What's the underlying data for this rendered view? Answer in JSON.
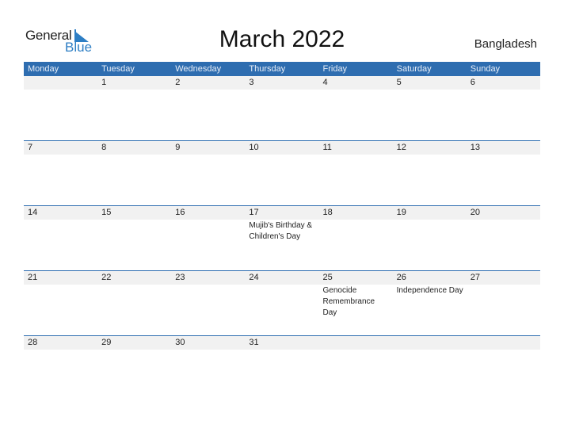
{
  "logo": {
    "general": "General",
    "blue": "Blue"
  },
  "title": "March 2022",
  "country": "Bangladesh",
  "weekdays": [
    "Monday",
    "Tuesday",
    "Wednesday",
    "Thursday",
    "Friday",
    "Saturday",
    "Sunday"
  ],
  "weeks": [
    {
      "days": [
        "",
        "1",
        "2",
        "3",
        "4",
        "5",
        "6"
      ],
      "events": [
        "",
        "",
        "",
        "",
        "",
        "",
        ""
      ]
    },
    {
      "days": [
        "7",
        "8",
        "9",
        "10",
        "11",
        "12",
        "13"
      ],
      "events": [
        "",
        "",
        "",
        "",
        "",
        "",
        ""
      ]
    },
    {
      "days": [
        "14",
        "15",
        "16",
        "17",
        "18",
        "19",
        "20"
      ],
      "events": [
        "",
        "",
        "",
        "Mujib's Birthday & Children's Day",
        "",
        "",
        ""
      ]
    },
    {
      "days": [
        "21",
        "22",
        "23",
        "24",
        "25",
        "26",
        "27"
      ],
      "events": [
        "",
        "",
        "",
        "",
        "Genocide Remembrance Day",
        "Independence Day",
        ""
      ]
    },
    {
      "days": [
        "28",
        "29",
        "30",
        "31",
        "",
        "",
        ""
      ],
      "events": [
        "",
        "",
        "",
        "",
        "",
        "",
        ""
      ]
    }
  ],
  "colors": {
    "header": "#2e6db0",
    "brand_blue": "#2d7ec4",
    "row_bg": "#f1f1f1"
  }
}
